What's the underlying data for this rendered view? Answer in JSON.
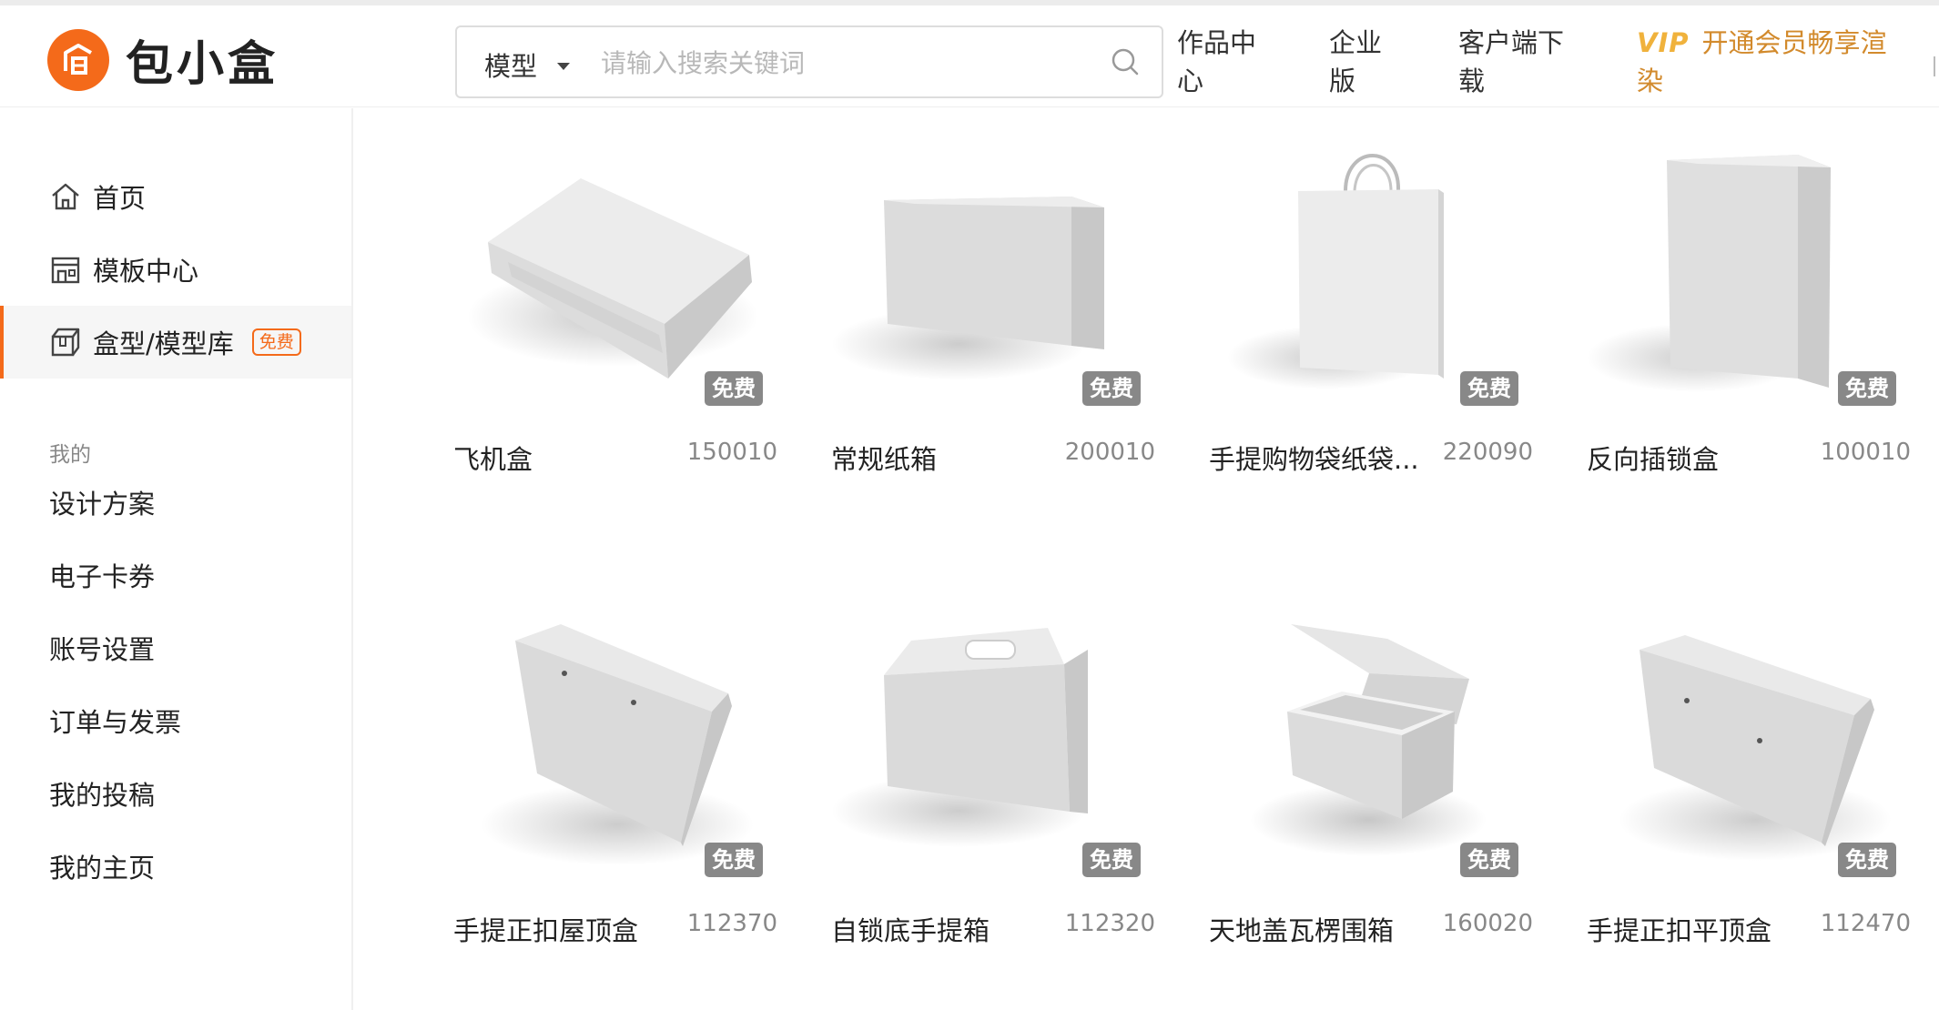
{
  "header": {
    "logo_text": "包小盒",
    "search": {
      "category": "模型",
      "placeholder": "请输入搜索关键词"
    },
    "nav": [
      {
        "label": "作品中心"
      },
      {
        "label": "企业版"
      },
      {
        "label": "客户端下载"
      }
    ],
    "vip": {
      "tag": "VIP",
      "label": "开通会员畅享渲染"
    }
  },
  "sidebar": {
    "items": [
      {
        "label": "首页",
        "icon": "home-icon"
      },
      {
        "label": "模板中心",
        "icon": "store-icon"
      },
      {
        "label": "盒型/模型库",
        "icon": "box-icon",
        "badge": "免费",
        "active": true
      }
    ],
    "section_title": "我的",
    "links": [
      "设计方案",
      "电子卡券",
      "账号设置",
      "订单与发票",
      "我的投稿",
      "我的主页"
    ]
  },
  "products": [
    {
      "title": "飞机盒",
      "id": "150010",
      "badge": "免费",
      "icon": "mailer-box"
    },
    {
      "title": "常规纸箱",
      "id": "200010",
      "badge": "免费",
      "icon": "carton-box"
    },
    {
      "title": "手提购物袋纸袋...",
      "id": "220090",
      "badge": "免费",
      "icon": "shopping-bag"
    },
    {
      "title": "反向插锁盒",
      "id": "100010",
      "badge": "免费",
      "icon": "tuck-end-box"
    },
    {
      "title": "手提正扣屋顶盒",
      "id": "112370",
      "badge": "免费",
      "icon": "gable-top-box"
    },
    {
      "title": "自锁底手提箱",
      "id": "112320",
      "badge": "免费",
      "icon": "handle-carrier-box"
    },
    {
      "title": "天地盖瓦楞围箱",
      "id": "160020",
      "badge": "免费",
      "icon": "lid-box-open"
    },
    {
      "title": "手提正扣平顶盒",
      "id": "112470",
      "badge": "免费",
      "icon": "flat-top-box"
    }
  ],
  "colors": {
    "accent": "#f46a1a",
    "vip": "#d28a2c"
  }
}
